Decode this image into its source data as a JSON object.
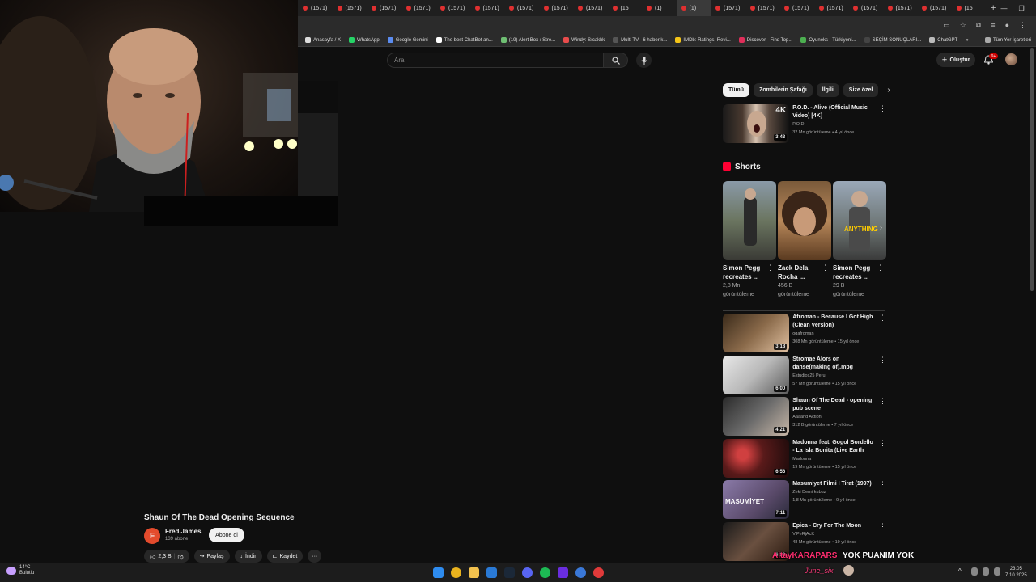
{
  "browser": {
    "tabs": [
      "(1571)",
      "(1571)",
      "(1571)",
      "(1571)",
      "(1571)",
      "(1571)",
      "(1571)",
      "(1571)",
      "(1571)",
      "(15",
      "(1)",
      "(1)",
      "(1571)",
      "(1571)",
      "(1571)",
      "(1571)",
      "(1571)",
      "(1571)",
      "(1571)",
      "(15"
    ],
    "active_tab_index": 11,
    "bookmarks": [
      "Anasayfa / X",
      "WhatsApp",
      "Google Gemini",
      "The best ChatBot an...",
      "(19) Alert Box / Stre...",
      "Windy: Sıcaklık",
      "Multi TV - 6 haber k...",
      "IMDb: Ratings, Revi...",
      "Discover - Find Top...",
      "Oyuneks - Türkiyeni...",
      "SEÇİM SONUÇLARI...",
      "ChatGPT"
    ],
    "bookmarks_more": "»",
    "all_bookmarks": "Tüm Yer İşaretleri",
    "new_tab": "+"
  },
  "youtube": {
    "search_placeholder": "Ara",
    "create_label": "Oluştur",
    "notif_badge": "9+",
    "chips": [
      "Tümü",
      "Zombilerin Şafağı",
      "İlgili",
      "Size özel"
    ],
    "top_video": {
      "title": "P.O.D. - Alive (Official Music Video) [4K]",
      "channel": "P.O.D.",
      "meta": "32 Mn görüntüleme • 4 yıl önce",
      "duration": "3:43",
      "badge": "4K"
    },
    "shorts_title": "Shorts",
    "shorts": [
      {
        "title": "Simon Pegg recreates ...",
        "views": "2,8 Mn görüntüleme"
      },
      {
        "title": "Zack Dela Rocha ...",
        "views": "456 B görüntüleme"
      },
      {
        "title": "Simon Pegg recreates ...",
        "views": "29 B görüntüleme"
      }
    ],
    "short_overlay_text": "ANYTHING",
    "videos": [
      {
        "title": "Afroman - Because I Got High (Clean Version)",
        "channel": "ogafroman",
        "meta": "308 Mn görüntüleme • 15 yıl önce",
        "duration": "3:18"
      },
      {
        "title": "Stromae   Alors on danse(making of).mpg",
        "channel": "Estudios25 Peru",
        "meta": "57 Mn görüntüleme • 15 yıl önce",
        "duration": "6:00"
      },
      {
        "title": "Shaun Of The Dead - opening pub scene",
        "channel": "Aaaand Action!",
        "meta": "312 B görüntüleme • 7 yıl önce",
        "duration": "4:21"
      },
      {
        "title": "Madonna feat. Gogol Bordello - La Isla Bonita (Live Earth 2007)",
        "channel": "Madonna",
        "meta": "19 Mn görüntüleme • 15 yıl önce",
        "duration": "6:56"
      },
      {
        "title": "Masumiyet Filmi I Tirat (1997)",
        "channel": "Zeki Demirkubuz",
        "meta": "1,8 Mn görüntüleme • 9 yıl önce",
        "duration": "7:11",
        "overlay": "MASUMİYET"
      },
      {
        "title": "Epica - Cry For The Moon",
        "channel": "ViPeRjAcK",
        "meta": "48 Mn görüntüleme • 19 yıl önce",
        "duration": "6:39"
      }
    ],
    "watch": {
      "title": "Shaun Of The Dead Opening Sequence",
      "channel_initial": "F",
      "channel": "Fred James",
      "subs": "139 abone",
      "subscribe": "Abone ol",
      "likes": "2,3 B",
      "share": "Paylaş",
      "download": "İndir",
      "save": "Kaydet",
      "more": "···"
    }
  },
  "taskbar": {
    "temp": "14°C",
    "weather": "Bulutlu",
    "time": "23:05",
    "date": "7.10.2025"
  },
  "stream_overlay": {
    "name": "AltayKARAPARS",
    "text": "YOK PUANIM YOK",
    "user": "June_six"
  }
}
